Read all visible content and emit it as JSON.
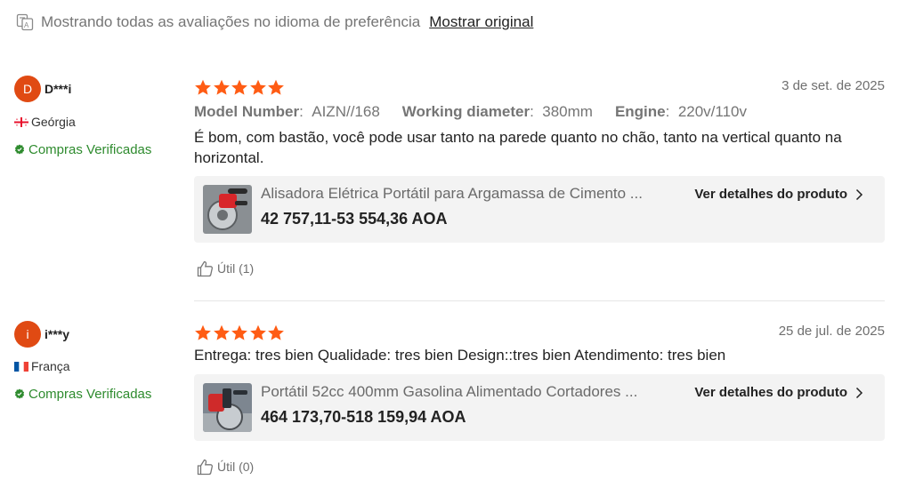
{
  "header": {
    "translate_icon": "translate-icon",
    "notice": "Mostrando todas as avaliações no idioma de preferência",
    "show_original": "Mostrar original"
  },
  "colors": {
    "avatar": "#e04a13",
    "star": "#ff5c14",
    "verified": "#2e8b2e",
    "card_bg": "#f3f3f3"
  },
  "reviews": [
    {
      "avatar_letter": "D",
      "username": "D***i",
      "country": "Geórgia",
      "flag_icon": "georgia-flag-icon",
      "verified": "Compras Verificadas",
      "rating": 5,
      "date": "3 de set. de 2025",
      "attributes": [
        {
          "name": "Model Number",
          "sep": ":",
          "value": "AIZN//168"
        },
        {
          "name": "Working diameter",
          "sep": ":",
          "value": "380mm"
        },
        {
          "name": "Engine",
          "sep": ":",
          "value": "220v/110v"
        }
      ],
      "text": "É bom, com bastão, você pode usar tanto na parede quanto no chão, tanto na vertical quanto na horizontal.",
      "product": {
        "title": "Alisadora Elétrica Portátil para Argamassa de Cimento ...",
        "price": "42 757,11-53 554,36 AOA",
        "details_label": "Ver detalhes do produto"
      },
      "helpful": "Útil (1)"
    },
    {
      "avatar_letter": "i",
      "username": "i***y",
      "country": "França",
      "flag_icon": "france-flag-icon",
      "verified": "Compras Verificadas",
      "rating": 5,
      "date": "25 de jul. de 2025",
      "attributes": [],
      "text": "Entrega: tres bien Qualidade: tres bien Design::tres bien  Atendimento: tres bien",
      "product": {
        "title": "Portátil 52cc 400mm Gasolina Alimentado Cortadores ...",
        "price": "464 173,70-518 159,94 AOA",
        "details_label": "Ver detalhes do produto"
      },
      "helpful": "Útil (0)"
    }
  ]
}
